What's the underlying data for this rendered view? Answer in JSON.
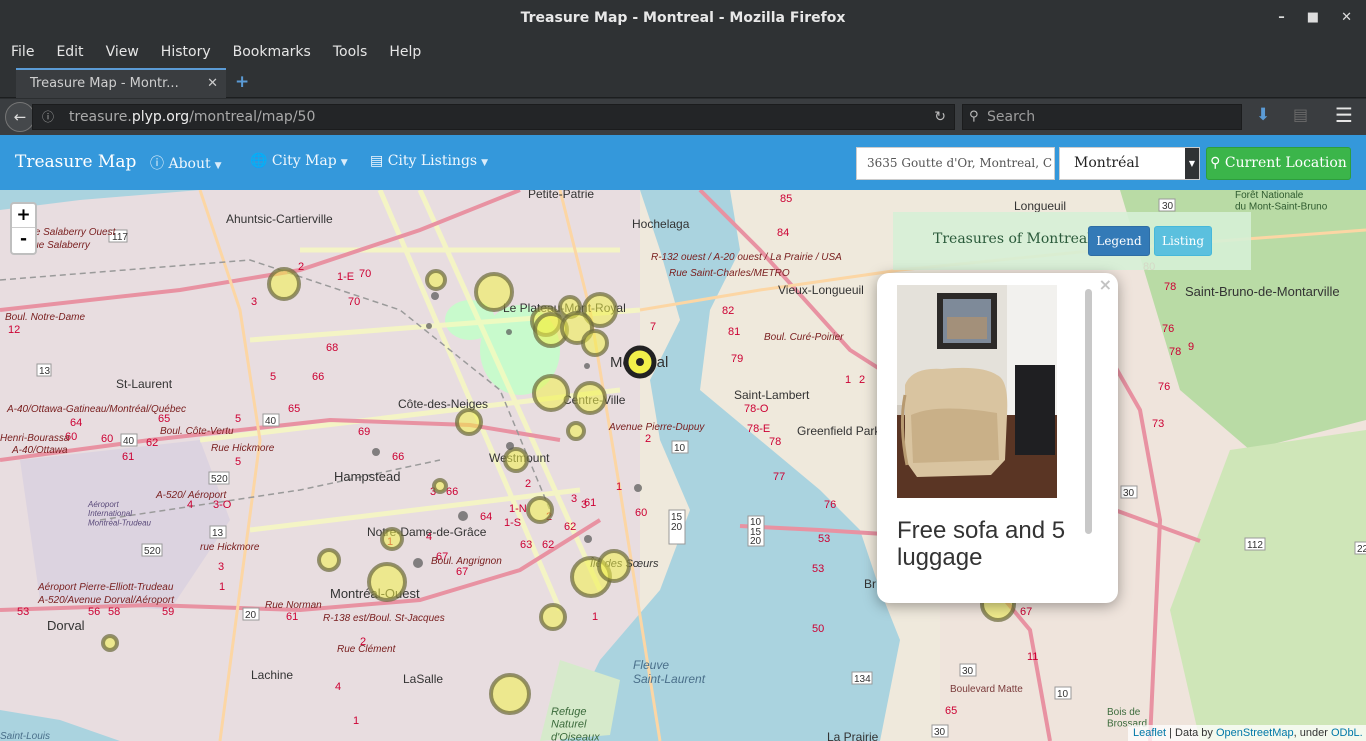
{
  "window": {
    "title": "Treasure Map - Montreal - Mozilla Firefox",
    "controls": {
      "minimize": "–",
      "maximize": "■",
      "close": "✕"
    }
  },
  "menubar": [
    "File",
    "Edit",
    "View",
    "History",
    "Bookmarks",
    "Tools",
    "Help"
  ],
  "tab": {
    "label": "Treasure Map - Montr...",
    "close": "✕",
    "new_tab": "+"
  },
  "urlbar": {
    "prefix": "treasure.",
    "host": "plyp.org",
    "path": "/montreal/map/50"
  },
  "searchbar": {
    "placeholder": "Search"
  },
  "site": {
    "brand": "Treasure Map",
    "nav": {
      "about": "About",
      "city_map": "City Map",
      "city_listings": "City Listings"
    },
    "address_value": "3635 Goutte d'Or, Montreal, C",
    "city_selected": "Montréal",
    "current_location": "Current Location"
  },
  "map": {
    "zoom_in": "+",
    "zoom_out": "-",
    "legend_title": "Treasures of Montreal",
    "legend_button": "Legend",
    "listing_button": "Listing",
    "popup_title": "Free sofa and 5 luggage",
    "popup_close": "×",
    "attribution": {
      "leaflet": "Leaflet",
      "data_by": " | Data by ",
      "osm": "OpenStreetMap",
      "under": ", under ",
      "odbl": "ODbL."
    },
    "labels": {
      "ahuntsic": "Ahuntsic-Cartierville",
      "petite_patrie": "Petite-Patrie",
      "hochelaga": "Hochelaga",
      "longueuil": "Longueuil",
      "foret": "Forêt Nationale\ndu Mont-Saint-Bruno",
      "saint_bruno": "Saint-Bruno-de-Montarville",
      "vieux_longueuil": "Vieux-Longueuil",
      "plateau": "Le Plateau-Mont-Royal",
      "montreal": "Montréal",
      "centre_ville": "Centre-Ville",
      "saint_laurent": "St-Laurent",
      "cote_des_neiges": "Côte-des-Neiges",
      "saint_lambert": "Saint-Lambert",
      "greenfield": "Greenfield Park",
      "westmount": "Westmount",
      "hampstead": "Hampstead",
      "ndg": "Notre-Dame-de-Grâce",
      "verdun": "Verdun",
      "ile_soeurs": "Île des Sœurs",
      "montreal_ouest": "Montréal-Ouest",
      "dorval": "Dorval",
      "lachine": "Lachine",
      "lasalle": "LaSalle",
      "fleuve": "Fleuve\nSaint-Laurent",
      "refuge": "Refuge\nNaturel\nd'Oiseaux",
      "aeroport": "Aéroport\nInternational\nMontréal-Trudeau",
      "aeroport2": "Aéroport Pierre-Elliott-Trudeau",
      "a520": "A-520/Avenue Dorval/Aéroport",
      "rue_norman": "Rue Norman",
      "boul_angrignon": "Boul. Angrignon",
      "rue_clement": "Rue Clément",
      "r138": "R-138 est/Boul. St-Jacques",
      "boul_cure": "Boul. Curé-Poirier",
      "avenue_pierre": "Avenue Pierre-Dupuy",
      "r132": "R-132 ouest / A-20 ouest / La Prairie / USA",
      "rue_st_charles": "Rue Saint-Charles/METRO",
      "a40": "A-40/Ottawa-Gatineau/Montréal/Québec",
      "salaberry_o": "Rue Salaberry Ouest",
      "salaberry": "Rue Salaberry",
      "boul_notre_dame": "Boul. Notre-Dame",
      "henri": "Henri-Bourassa",
      "a40b": "A-40/Ottawa",
      "cote_vertu": "Boul. Côte-Vertu",
      "rue_hickmore": "Rue Hickmore",
      "a520b": "A-520/ Aéroport",
      "rue_hickmore2": "rue Hickmore",
      "boulevard_matte": "Boulevard Matte",
      "bois": "Bois de\nBrossard",
      "la_prairie": "La Prairie",
      "saint_louis": "Saint-Louis",
      "br": "Br"
    }
  },
  "colors": {
    "site_nav": "#3498db",
    "location_button": "#3bb54a",
    "legend_button": "#337ab7",
    "listing_button": "#5bc0de",
    "marker_fill": "#f1f04a",
    "marker_ring": "#6b6a3a",
    "water": "#aad3df",
    "park": "#c8facc"
  },
  "icons": {
    "info": "info-circle-icon",
    "globe": "globe-icon",
    "list": "list-icon",
    "map_marker": "map-marker-icon"
  }
}
